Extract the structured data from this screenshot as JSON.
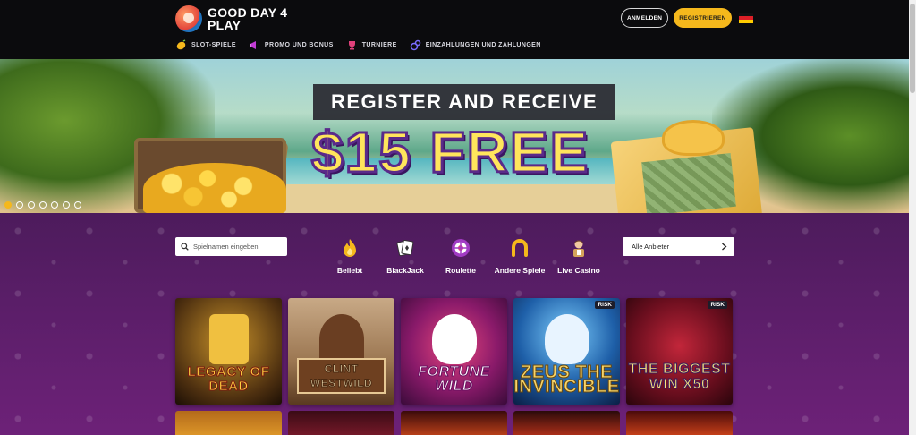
{
  "header": {
    "logo_text": "GOOD DAY 4 PLAY",
    "nav": [
      {
        "label": "SLOT-SPIELE",
        "icon": "lemon-icon",
        "color": "#f5b81c"
      },
      {
        "label": "PROMO UND BONUS",
        "icon": "megaphone-icon",
        "color": "#c23bd4"
      },
      {
        "label": "TURNIERE",
        "icon": "trophy-icon",
        "color": "#e0407a"
      },
      {
        "label": "EINZAHLUNGEN UND ZAHLUNGEN",
        "icon": "coins-icon",
        "color": "#7a6cff"
      }
    ],
    "login_label": "ANMELDEN",
    "register_label": "REGISTRIEREN",
    "language": "de-flag-icon"
  },
  "banner": {
    "headline": "REGISTER AND RECEIVE",
    "offer": "$15 FREE",
    "slide_count": 7,
    "active_slide": 1
  },
  "filters": {
    "search_placeholder": "Spielnamen eingeben",
    "categories": [
      {
        "label": "Beliebt",
        "icon": "flame-icon"
      },
      {
        "label": "BlackJack",
        "icon": "cards-icon"
      },
      {
        "label": "Roulette",
        "icon": "roulette-icon"
      },
      {
        "label": "Andere Spiele",
        "icon": "horseshoe-icon"
      },
      {
        "label": "Live Casino",
        "icon": "dealer-icon"
      }
    ],
    "provider_label": "Alle Anbieter"
  },
  "games": [
    {
      "title": "LEGACY OF DEAD"
    },
    {
      "title": "CLINT WESTWILD"
    },
    {
      "title": "FORTUNE WILD"
    },
    {
      "title": "ZEUS THE INVINCIBLE",
      "badge": "RISK"
    },
    {
      "title": "THE BIGGEST WIN X50",
      "badge": "RISK"
    }
  ],
  "colors": {
    "accent": "#f5b81c",
    "header_bg": "#0b0b0d",
    "content_bg": "#5a1e68"
  }
}
